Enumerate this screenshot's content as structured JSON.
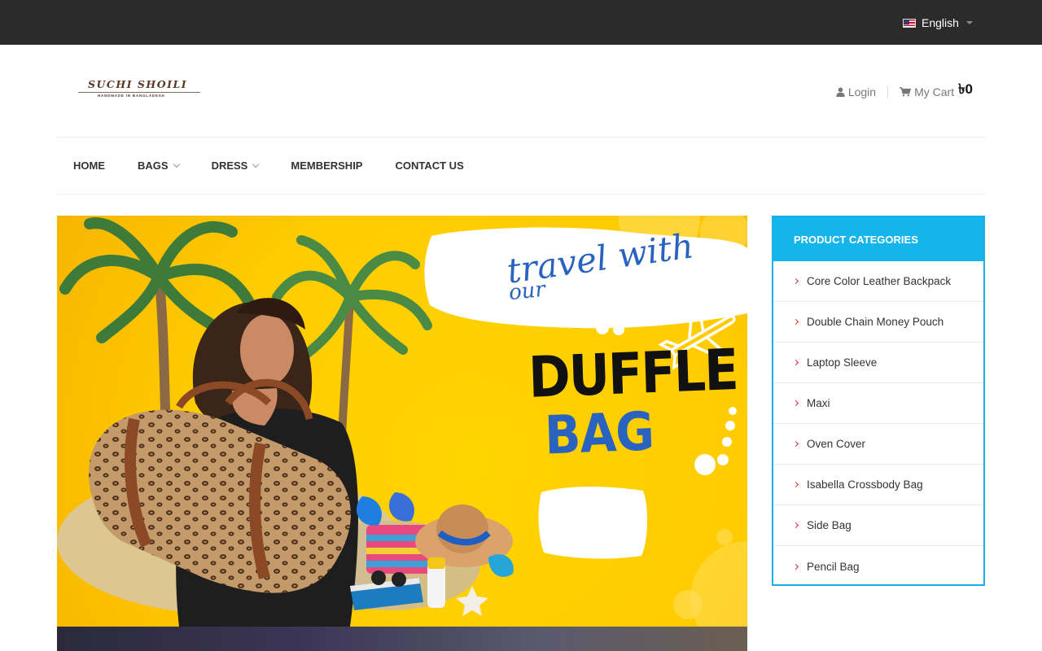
{
  "topbar": {
    "language": "English"
  },
  "logo": {
    "title": "SUCHI SHOILI",
    "tagline": "HANDMADE IN BANGLADESH"
  },
  "header": {
    "login_label": "Login",
    "cart_label": "My Cart",
    "cart_amount": "৳0"
  },
  "nav": {
    "items": [
      {
        "label": "HOME",
        "has_dropdown": false
      },
      {
        "label": "BAGS",
        "has_dropdown": true
      },
      {
        "label": "DRESS",
        "has_dropdown": true
      },
      {
        "label": "MEMBERSHIP",
        "has_dropdown": false
      },
      {
        "label": "CONTACT US",
        "has_dropdown": false
      }
    ]
  },
  "banner": {
    "line1": "travel with",
    "line2": "our",
    "headline1": "DUFFLE",
    "headline2": "BAG"
  },
  "sidebar": {
    "title": "PRODUCT CATEGORIES",
    "categories": [
      "Core Color Leather Backpack",
      "Double Chain Money Pouch",
      "Laptop Sleeve",
      "Maxi",
      "Oven Cover",
      "Isabella Crossbody Bag",
      "Side Bag",
      "Pencil Bag"
    ]
  },
  "colors": {
    "topbar": "#2b2b2b",
    "accent": "#13b5ea",
    "banner_yellow": "#ffcc00",
    "chevron_red": "#e0262b"
  }
}
